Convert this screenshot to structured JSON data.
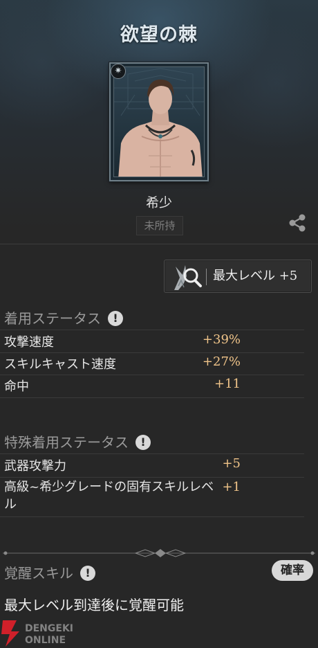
{
  "header": {
    "title": "欲望の棘"
  },
  "card": {
    "rarity": "希少",
    "ownership": "未所持",
    "badge_icon": "compass-star-icon",
    "share_icon": "share-icon"
  },
  "max_level_button": {
    "label": "最大レベル +5",
    "icon": "rune-magnifier-icon"
  },
  "equip_status": {
    "heading": "着用ステータス",
    "info_icon": "!",
    "rows": [
      {
        "name": "攻撃速度",
        "value": "+39%"
      },
      {
        "name": "スキルキャスト速度",
        "value": "+27%"
      },
      {
        "name": "命中",
        "value": "+11"
      }
    ]
  },
  "special_status": {
    "heading": "特殊着用ステータス",
    "info_icon": "!",
    "rows": [
      {
        "name": "武器攻撃力",
        "value": "+5"
      },
      {
        "name": "高級~希少グレードの固有スキルレベル",
        "value": "+1"
      }
    ]
  },
  "awaken": {
    "heading": "覚醒スキル",
    "info_icon": "!",
    "probability_button": "確率",
    "description": "最大レベル到達後に覚醒可能"
  },
  "watermark": {
    "line1": "DENGEKI",
    "line2": "ONLINE"
  },
  "colors": {
    "stat_value": "#f1c58a",
    "background": "#272727"
  }
}
